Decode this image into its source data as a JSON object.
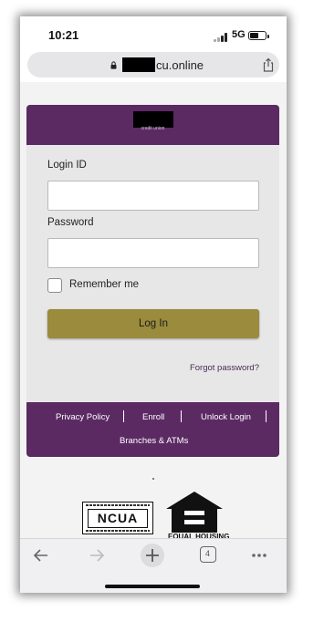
{
  "status_bar": {
    "time": "10:21",
    "network": "5G"
  },
  "browser": {
    "url_suffix": "cu.online"
  },
  "login_card": {
    "header_subtitle": "credit union",
    "login_id_label": "Login ID",
    "login_id_value": "",
    "password_label": "Password",
    "password_value": "",
    "remember_label": "Remember me",
    "login_button": "Log In",
    "forgot_link": "Forgot password?"
  },
  "footer_links": {
    "privacy": "Privacy Policy",
    "enroll": "Enroll",
    "unlock": "Unlock Login",
    "branches": "Branches & ATMs"
  },
  "badges": {
    "ncua": "NCUA",
    "equal_housing": "EQUAL HOUSING"
  },
  "toolbar": {
    "tab_count": "4"
  },
  "colors": {
    "brand_purple": "#5b2a63",
    "button_gold": "#9a8b3d"
  },
  "icons": [
    "lock-icon",
    "share-icon",
    "back-icon",
    "forward-icon",
    "new-tab-icon",
    "tabs-icon",
    "more-icon"
  ]
}
